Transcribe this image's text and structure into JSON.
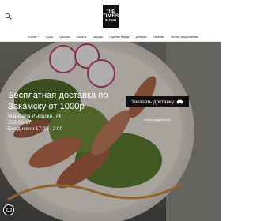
{
  "header": {
    "logo_line1": "THE",
    "logo_line2": "TIMES",
    "logo_line3": "SUSHI"
  },
  "nav": {
    "items": [
      {
        "label": "Роллы",
        "has_dropdown": true
      },
      {
        "label": "Суши",
        "has_dropdown": false
      },
      {
        "label": "Гунканы",
        "has_dropdown": false
      },
      {
        "label": "Салаты",
        "has_dropdown": false
      },
      {
        "label": "Закуски",
        "has_dropdown": false
      },
      {
        "label": "Горячие блюда",
        "has_dropdown": false
      },
      {
        "label": "Десерты",
        "has_dropdown": false
      },
      {
        "label": "Напитки",
        "has_dropdown": false
      },
      {
        "label": "Летние предложения",
        "has_dropdown": false
      }
    ]
  },
  "hero": {
    "title": "Бесплатная доставка по Закамску от 1000р",
    "address": "Маршала Рыбалко, 74",
    "phone": "252-06-17",
    "hours": "Ежедневно 17:00 - 2:00",
    "cta_label": "Заказать доставку",
    "cta_sub": "Узнать подробности"
  },
  "icons": {
    "search": "search-icon",
    "car": "car-icon",
    "chat": "chat-icon"
  },
  "colors": {
    "accent": "#111111",
    "text_on_dark": "#ffffff"
  }
}
